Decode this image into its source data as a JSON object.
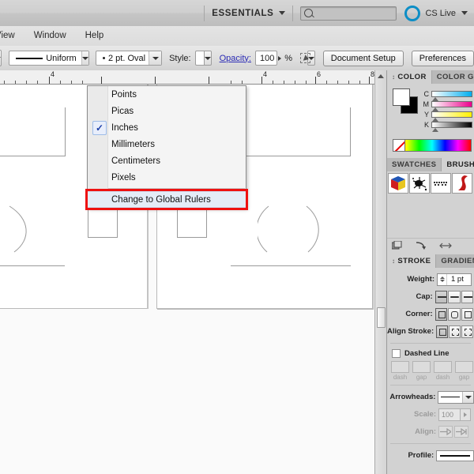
{
  "appbar": {
    "workspace_label": "ESSENTIALS",
    "workspace_caret": "chevron-down-icon",
    "search_placeholder": "",
    "search_value": "",
    "cslive_label": "CS Live",
    "cslive_caret": "chevron-down-icon"
  },
  "menubar": {
    "items": [
      {
        "label": "View"
      },
      {
        "label": "Window"
      },
      {
        "label": "Help"
      }
    ]
  },
  "optionsbar": {
    "stroke_profile": "Uniform",
    "brush_definition": "2 pt. Oval",
    "style_label": "Style:",
    "opacity_label": "Opacity:",
    "opacity_value": "100",
    "percent": "%",
    "document_setup": "Document Setup",
    "preferences": "Preferences"
  },
  "ruler": {
    "unit": "Inches",
    "labels": [
      "4",
      "4",
      "6",
      "8"
    ]
  },
  "context_menu": {
    "items": [
      {
        "label": "Points",
        "checked": false
      },
      {
        "label": "Picas",
        "checked": false
      },
      {
        "label": "Inches",
        "checked": true
      },
      {
        "label": "Millimeters",
        "checked": false
      },
      {
        "label": "Centimeters",
        "checked": false
      },
      {
        "label": "Pixels",
        "checked": false
      }
    ],
    "footer_item": {
      "label": "Change to Global Rulers",
      "highlighted": true
    },
    "highlight_color": "#ee1111"
  },
  "color_panel": {
    "tabs": [
      {
        "label": "COLOR",
        "active": true
      },
      {
        "label": "COLOR GU",
        "active": false
      }
    ],
    "sliders": [
      {
        "label": "C",
        "value": 0
      },
      {
        "label": "M",
        "value": 0
      },
      {
        "label": "Y",
        "value": 0
      },
      {
        "label": "K",
        "value": 0
      }
    ],
    "fill": "#ffffff",
    "stroke": "#000000",
    "none_swatch": "none-icon"
  },
  "brushes_panel": {
    "tabs": [
      {
        "label": "SWATCHES",
        "active": false
      },
      {
        "label": "BRUSHES",
        "active": true
      }
    ],
    "brushes": [
      {
        "name": "cube-brush"
      },
      {
        "name": "ink-splat-brush"
      },
      {
        "name": "dotted-pattern-brush"
      },
      {
        "name": "red-ribbon-brush"
      }
    ],
    "footer_icons": [
      "libraries-icon",
      "remove-brush-link-icon",
      "options-icon"
    ]
  },
  "stroke_panel": {
    "tabs": [
      {
        "label": "STROKE",
        "active": true
      },
      {
        "label": "GRADIEN",
        "active": false
      }
    ],
    "weight_label": "Weight:",
    "weight_value": "1 pt",
    "cap_label": "Cap:",
    "corner_label": "Corner:",
    "align_label": "Align Stroke:",
    "dashed_label": "Dashed Line",
    "dashed_checked": false,
    "dash_fields": [
      "",
      "",
      "",
      ""
    ],
    "dash_captions": [
      "dash",
      "gap",
      "dash",
      "gap"
    ],
    "arrowheads_label": "Arrowheads:",
    "scale_label": "Scale:",
    "scale_value": "100",
    "align_arrow_label": "Align:",
    "profile_label": "Profile:"
  },
  "canvas": {
    "artboards": [
      {
        "name": "artboard-left"
      },
      {
        "name": "artboard-right"
      }
    ]
  }
}
